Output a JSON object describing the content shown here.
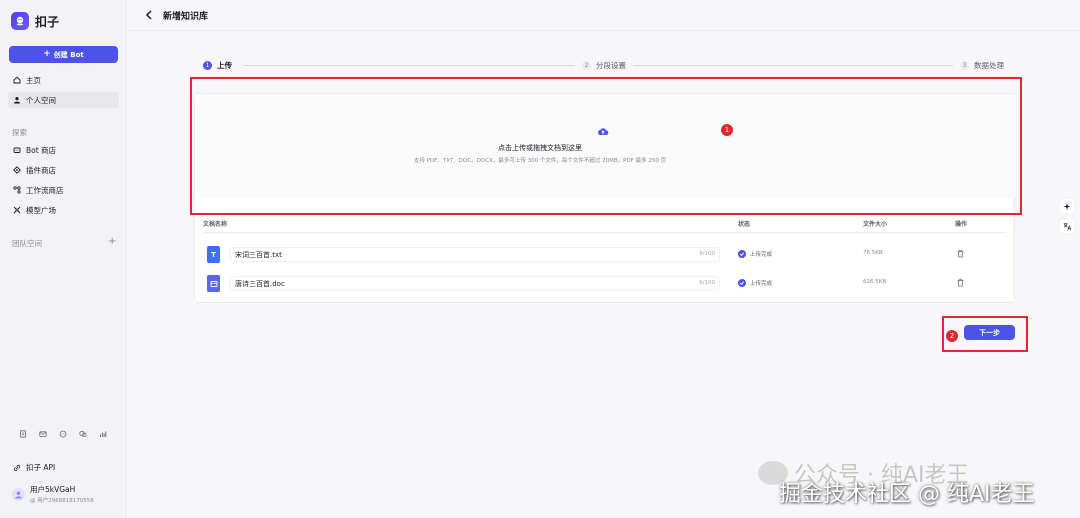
{
  "app": {
    "name": "扣子"
  },
  "sidebar": {
    "create_label": "创建 Bot",
    "nav": [
      {
        "label": "主页",
        "icon": "home-icon"
      },
      {
        "label": "个人空间",
        "icon": "person-icon"
      }
    ],
    "explore_label": "探索",
    "explore": [
      {
        "label": "Bot 商店",
        "icon": "bot-icon"
      },
      {
        "label": "插件商店",
        "icon": "plugin-icon"
      },
      {
        "label": "工作流商店",
        "icon": "workflow-icon"
      },
      {
        "label": "模型广场",
        "icon": "model-icon"
      }
    ],
    "team_label": "团队空间",
    "api_label": "扣子 API",
    "user": {
      "name": "用户5kVGaH",
      "sub": "@ 用户2968818170558"
    }
  },
  "header": {
    "title": "新增知识库"
  },
  "steps": [
    {
      "num": "1",
      "label": "上传"
    },
    {
      "num": "2",
      "label": "分段设置"
    },
    {
      "num": "3",
      "label": "数据处理"
    }
  ],
  "upload": {
    "text": "点击上传或拖拽文档到这里",
    "hint": "支持 PDF、TXT、DOC、DOCX，最多可上传 300 个文件，每个文件不超过 20MB，PDF 最多 250 页"
  },
  "table": {
    "headers": {
      "name": "文档名称",
      "status": "状态",
      "size": "文件大小",
      "action": "操作"
    },
    "rows": [
      {
        "name": "宋词三百首.txt",
        "count": "9/100",
        "status": "上传完成",
        "size": "76.5KB",
        "icon": "T"
      },
      {
        "name": "唐诗三百首.doc",
        "count": "9/100",
        "status": "上传完成",
        "size": "626.5KB",
        "icon": ""
      }
    ]
  },
  "next_label": "下一步",
  "annotations": {
    "badge1": "1",
    "badge2": "2"
  },
  "watermark": {
    "line1": "公众号 · 纯AI老王",
    "line2": "掘金技术社区 @ 纯AI老王"
  },
  "colors": {
    "accent": "#4d53e8",
    "annotation": "#e0282e"
  }
}
